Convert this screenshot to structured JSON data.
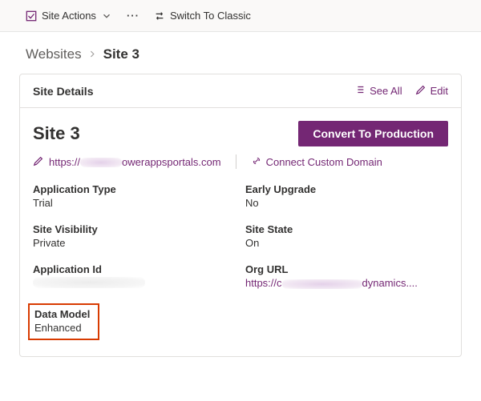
{
  "cmdbar": {
    "site_actions": "Site Actions",
    "switch_classic": "Switch To Classic"
  },
  "breadcrumb": {
    "root": "Websites",
    "leaf": "Site 3"
  },
  "card": {
    "title": "Site Details",
    "see_all": "See All",
    "edit": "Edit"
  },
  "site": {
    "name": "Site 3",
    "convert_btn": "Convert To Production",
    "url_prefix": "https://",
    "url_suffix": "owerappsportals.com",
    "connect_domain": "Connect Custom Domain"
  },
  "fields": {
    "app_type_label": "Application Type",
    "app_type_value": "Trial",
    "early_upgrade_label": "Early Upgrade",
    "early_upgrade_value": "No",
    "visibility_label": "Site Visibility",
    "visibility_value": "Private",
    "state_label": "Site State",
    "state_value": "On",
    "app_id_label": "Application Id",
    "org_url_label": "Org URL",
    "org_url_prefix": "https://c",
    "org_url_suffix": "dynamics....",
    "data_model_label": "Data Model",
    "data_model_value": "Enhanced"
  }
}
